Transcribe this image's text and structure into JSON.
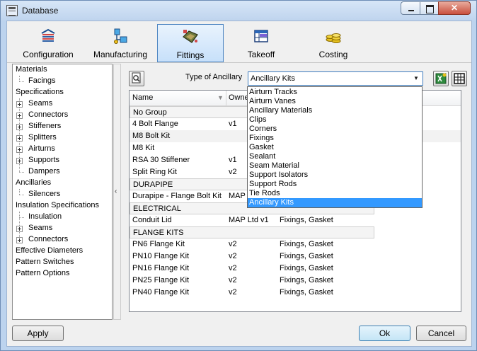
{
  "window": {
    "title": "Database"
  },
  "toolbar": {
    "items": [
      {
        "label": "Configuration",
        "icon": "configuration-icon"
      },
      {
        "label": "Manufacturing",
        "icon": "manufacturing-icon"
      },
      {
        "label": "Fittings",
        "icon": "fittings-icon",
        "active": true
      },
      {
        "label": "Takeoff",
        "icon": "takeoff-icon"
      },
      {
        "label": "Costing",
        "icon": "costing-icon"
      }
    ]
  },
  "tree": {
    "items": [
      {
        "label": "Materials",
        "level": 0
      },
      {
        "label": "Facings",
        "level": 1
      },
      {
        "label": "Specifications",
        "level": 0
      },
      {
        "label": "Seams",
        "level": 1,
        "expander": true
      },
      {
        "label": "Connectors",
        "level": 1,
        "expander": true
      },
      {
        "label": "Stiffeners",
        "level": 1,
        "expander": true
      },
      {
        "label": "Splitters",
        "level": 1,
        "expander": true
      },
      {
        "label": "Airturns",
        "level": 1,
        "expander": true
      },
      {
        "label": "Supports",
        "level": 1,
        "expander": true
      },
      {
        "label": "Dampers",
        "level": 1
      },
      {
        "label": "Ancillaries",
        "level": 0
      },
      {
        "label": "Silencers",
        "level": 1
      },
      {
        "label": "Insulation Specifications",
        "level": 0
      },
      {
        "label": "Insulation",
        "level": 1
      },
      {
        "label": "Seams",
        "level": 1,
        "expander": true
      },
      {
        "label": "Connectors",
        "level": 1,
        "expander": true
      },
      {
        "label": "Effective Diameters",
        "level": 0
      },
      {
        "label": "Pattern Switches",
        "level": 0
      },
      {
        "label": "Pattern Options",
        "level": 0
      }
    ]
  },
  "filter": {
    "type_label": "Type of Ancillary",
    "selected": "Ancillary Kits",
    "options": [
      "Airturn Tracks",
      "Airturn Vanes",
      "Ancillary Materials",
      "Clips",
      "Corners",
      "Fixings",
      "Gasket",
      "Sealant",
      "Seam Material",
      "Support Isolators",
      "Support Rods",
      "Tie Rods",
      "Ancillary Kits"
    ]
  },
  "grid": {
    "columns": [
      "Name",
      "Owne"
    ],
    "rows": [
      {
        "kind": "group",
        "name": "No Group"
      },
      {
        "kind": "row",
        "name": "4 Bolt Flange",
        "owner": "v1",
        "items": ""
      },
      {
        "kind": "row",
        "name": "M8 Bolt Kit",
        "owner": "",
        "items": "",
        "alt": true
      },
      {
        "kind": "row",
        "name": "M8 Kit",
        "owner": "",
        "items": ""
      },
      {
        "kind": "row",
        "name": "RSA 30 Stiffener",
        "owner": "v1",
        "items": ""
      },
      {
        "kind": "row",
        "name": "Split Ring Kit",
        "owner": "v2",
        "items": ""
      },
      {
        "kind": "group",
        "name": "DURAPIPE"
      },
      {
        "kind": "row",
        "name": "Durapipe - Flange Bolt Kit",
        "owner": "MAP",
        "items": ""
      },
      {
        "kind": "group",
        "name": "ELECTRICAL"
      },
      {
        "kind": "row",
        "name": "Conduit Lid",
        "owner": "MAP Ltd v1",
        "items": "Fixings, Gasket"
      },
      {
        "kind": "group",
        "name": "FLANGE KITS"
      },
      {
        "kind": "row",
        "name": "PN6 Flange Kit",
        "owner": "v2",
        "items": "Fixings, Gasket"
      },
      {
        "kind": "row",
        "name": "PN10 Flange Kit",
        "owner": "v2",
        "items": "Fixings, Gasket"
      },
      {
        "kind": "row",
        "name": "PN16 Flange Kit",
        "owner": "v2",
        "items": "Fixings, Gasket"
      },
      {
        "kind": "row",
        "name": "PN25 Flange Kit",
        "owner": "v2",
        "items": "Fixings, Gasket"
      },
      {
        "kind": "row",
        "name": "PN40 Flange Kit",
        "owner": "v2",
        "items": "Fixings, Gasket"
      }
    ]
  },
  "buttons": {
    "apply": "Apply",
    "ok": "Ok",
    "cancel": "Cancel"
  },
  "colors": {
    "accent": "#3399ff",
    "window_frame": "#bcd3ee",
    "active_tab": "#c7e0fa"
  }
}
